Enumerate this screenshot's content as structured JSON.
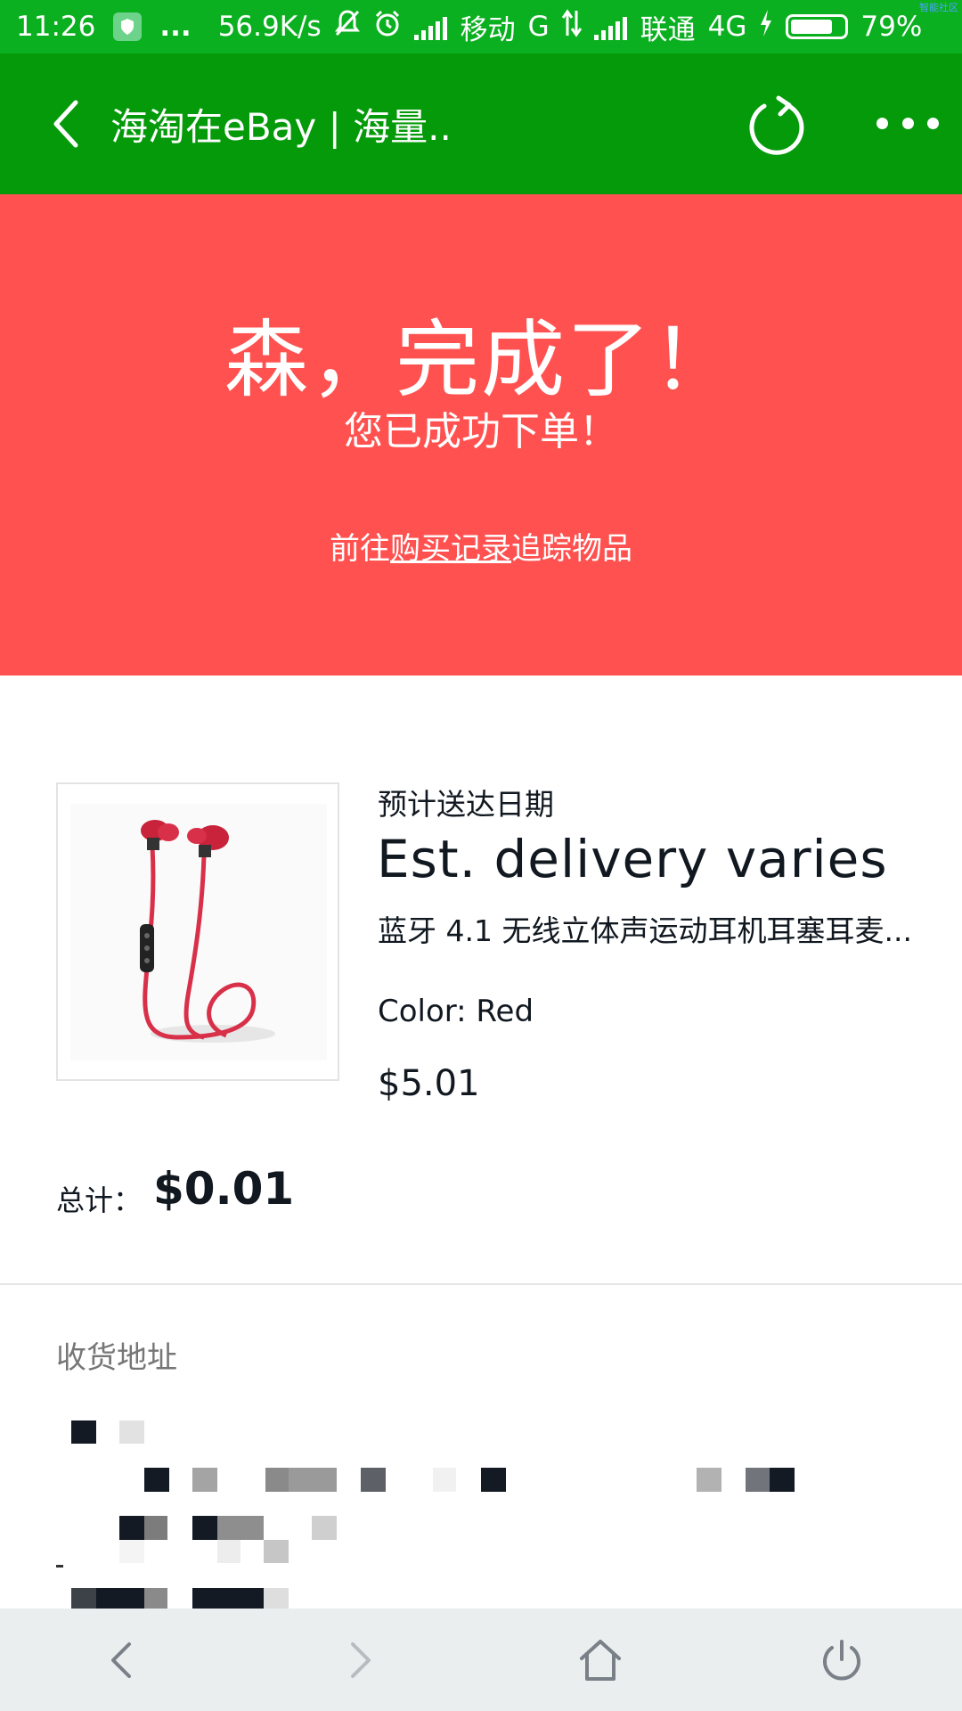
{
  "status_bar": {
    "time": "11:26",
    "ellipsis": "...",
    "net_speed": "56.9K/s",
    "carrier1": "移动",
    "carrier1_net": "G",
    "carrier2": "联通",
    "carrier2_net": "4G",
    "battery_text": "79%",
    "battery_level": 0.79,
    "corner_tag": "智能社区"
  },
  "title_bar": {
    "title": "海淘在eBay | 海量.."
  },
  "banner": {
    "headline": "森，完成了！",
    "subtitle": "您已成功下单！",
    "track_prefix": "前往",
    "track_link": "购买记录",
    "track_suffix": "追踪物品"
  },
  "order_item": {
    "delivery_label": "预计送达日期",
    "delivery_value": "Est. delivery varies",
    "title": "蓝牙 4.1 无线立体声运动耳机耳塞耳麦...",
    "color": "Color: Red",
    "price": "$5.01"
  },
  "total": {
    "label": "总计：",
    "value": "$0.01"
  },
  "address": {
    "label": "收货地址"
  },
  "icons": {
    "back": "chevron-left-icon",
    "reload": "reload-icon",
    "more": "more-dots-icon",
    "nav_back": "nav-back-icon",
    "nav_forward": "nav-forward-icon",
    "nav_home": "home-icon",
    "nav_power": "power-icon"
  },
  "colors": {
    "status_bar": "#0bb020",
    "title_bar": "#049a0a",
    "banner": "#ff5250",
    "bottom_nav": "#eaeeee"
  }
}
